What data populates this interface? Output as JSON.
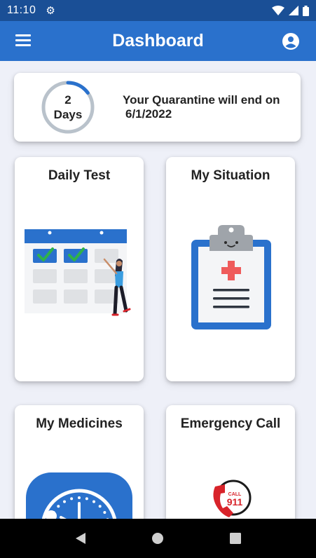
{
  "status_bar": {
    "time": "11:10"
  },
  "app_bar": {
    "title": "Dashboard"
  },
  "quarantine": {
    "days_value": "2",
    "days_unit": "Days",
    "message": "Your Quarantine will end on",
    "end_date": "6/1/2022",
    "progress": 0.15
  },
  "tiles": [
    {
      "title": "Daily Test"
    },
    {
      "title": "My Situation"
    },
    {
      "title": "My Medicines"
    },
    {
      "title": "Emergency Call"
    }
  ],
  "emergency_badge": {
    "line1": "CALL",
    "line2": "911"
  },
  "colors": {
    "status_bar": "#1a4f96",
    "app_bar": "#2a71cc",
    "accent": "#2a71cc",
    "ring_track": "#b9c2cb",
    "check": "#2fb24a",
    "danger": "#d8232a"
  },
  "icons": [
    "gear-icon",
    "wifi-icon",
    "signal-icon",
    "battery-icon",
    "menu-icon",
    "account-icon",
    "back-icon",
    "home-icon",
    "recents-icon"
  ]
}
